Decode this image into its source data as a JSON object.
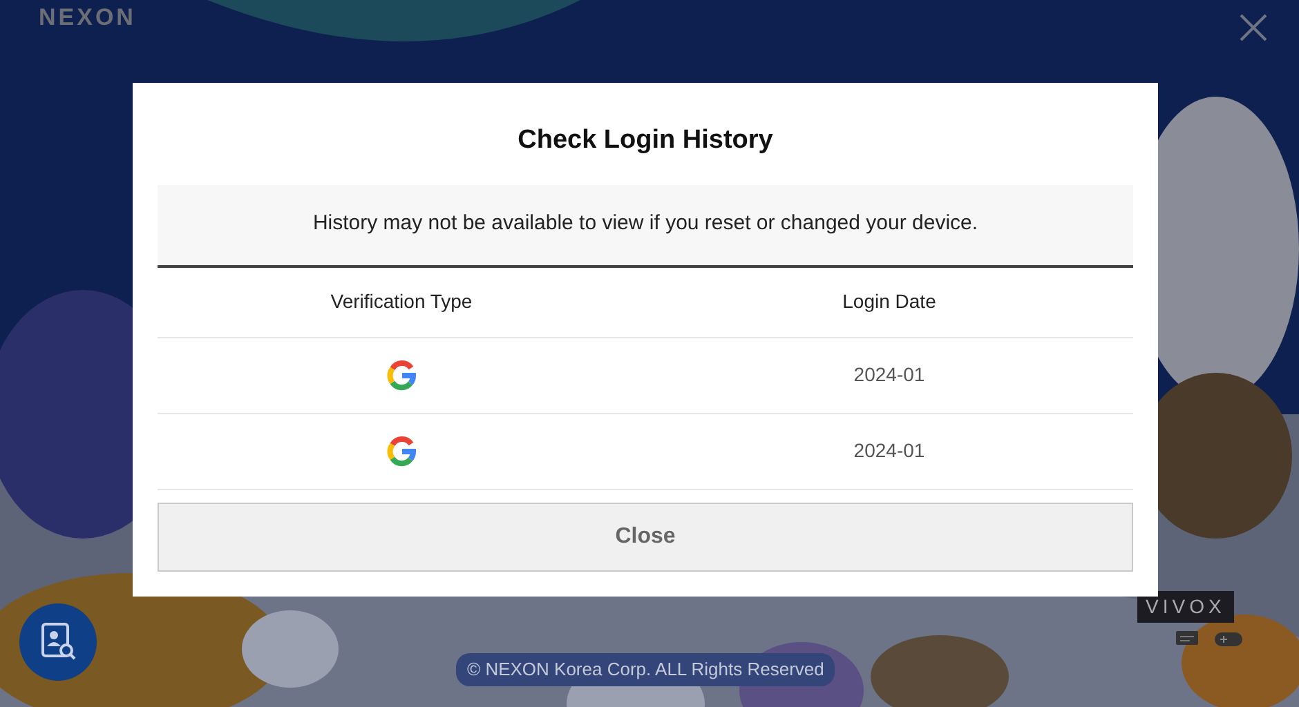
{
  "brand": "NEXON",
  "modal": {
    "title": "Check Login History",
    "notice": "History may not be available to view if you reset or changed your device.",
    "columns": [
      "Verification Type",
      "Login Date"
    ],
    "rows": [
      {
        "verification": {
          "kind": "google"
        },
        "login_date": "2024-01"
      },
      {
        "verification": {
          "kind": "google"
        },
        "login_date": "2024-01"
      }
    ],
    "button": "Close"
  },
  "voice_badge": "VIVOX",
  "copyright": "© NEXON Korea Corp. ALL Rights Reserved"
}
